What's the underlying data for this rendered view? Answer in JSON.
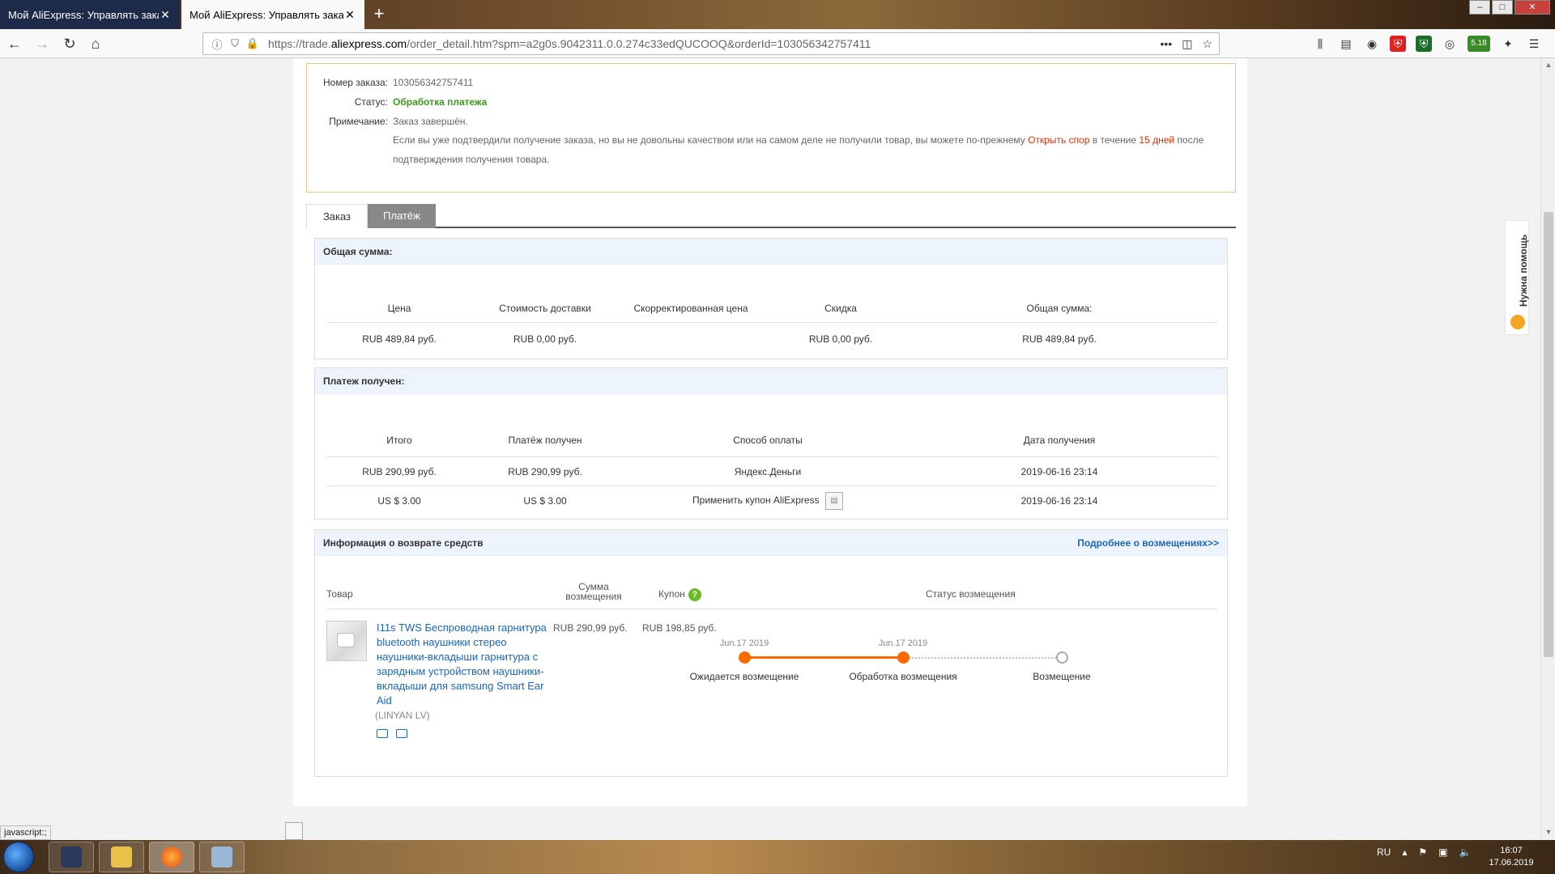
{
  "browser": {
    "tabs": [
      {
        "label": "Мой AliExpress: Управлять заказа"
      },
      {
        "label": "Мой AliExpress: Управлять заказа"
      }
    ],
    "new_tab": "+",
    "url_prefix": "https://trade.",
    "url_domain": "aliexpress.com",
    "url_rest": "/order_detail.htm?spm=a2g0s.9042311.0.0.274c33edQUCOOQ&orderId=103056342757411",
    "url_menu": "•••",
    "extension_badge": "5.18"
  },
  "order": {
    "number_label": "Номер заказа:",
    "number_value": "103056342757411",
    "status_label": "Статус:",
    "status_value": "Обработка платежа",
    "note_label": "Примечание:",
    "note_value": "Заказ завершён.",
    "note_line1_pre": "Если вы уже подтвердили получение заказа, но вы не довольны качеством или на самом деле не получили товар, вы можете по-прежнему ",
    "note_link": "Открыть спор",
    "note_mid": " в течение ",
    "note_days": "15 дней",
    "note_post": " после",
    "note_line2": "подтверждения получения товара."
  },
  "page_tabs": {
    "order": "Заказ",
    "payment": "Платёж"
  },
  "total": {
    "heading": "Общая сумма:",
    "columns": [
      "Цена",
      "Стоимость доставки",
      "Скорректированная цена",
      "Скидка",
      "Общая сумма:"
    ],
    "row": [
      "RUB 489,84 руб.",
      "RUB 0,00 руб.",
      "",
      "RUB 0,00 руб.",
      "RUB 489,84 руб."
    ]
  },
  "payment": {
    "heading": "Платеж получен:",
    "columns": [
      "Итого",
      "Платёж получен",
      "Способ оплаты",
      "Дата получения"
    ],
    "rows": [
      [
        "RUB 290,99 руб.",
        "RUB 290,99 руб.",
        "Яндекс.Деньги",
        "2019-06-16 23:14"
      ],
      [
        "US $ 3.00",
        "US $ 3.00",
        "Применить купон AliExpress",
        "2019-06-16 23:14"
      ]
    ]
  },
  "refund": {
    "heading": "Информация о возврате средств",
    "more_link": "Подробнее о возмещениях>>",
    "col_product": "Товар",
    "col_amount_1": "Сумма",
    "col_amount_2": "возмещения",
    "col_coupon": "Купон",
    "col_status": "Статус возмещения",
    "product_title": "I11s TWS Беспроводная гарнитура bluetooth наушники стерео наушники-вкладыши гарнитура с зарядным устройством наушники-вкладыши для samsung Smart Ear Aid",
    "seller": "(LINYAN LV)",
    "amount": "RUB 290,99 руб.",
    "coupon": "RUB 198,85 руб.",
    "timeline": [
      {
        "date": "Jun.17 2019",
        "label": "Ожидается возмещение",
        "done": true
      },
      {
        "date": "Jun.17 2019",
        "label": "Обработка возмещения",
        "done": true
      },
      {
        "date": "",
        "label": "Возмещение",
        "done": false
      }
    ]
  },
  "help_tab": "Нужна помощь",
  "status_text": "javascript:;",
  "taskbar": {
    "lang": "RU",
    "time": "16:07",
    "date": "17.06.2019"
  },
  "colors": {
    "accent_orange": "#ff6a00",
    "link_blue": "#1a66c2",
    "status_green": "#3a9a1a",
    "alert_red": "#e62e04"
  }
}
